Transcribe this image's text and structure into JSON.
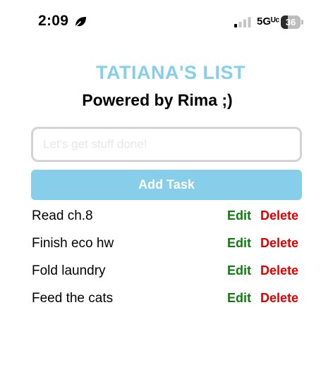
{
  "status_bar": {
    "time": "2:09",
    "network": "5Gᵁᶜ",
    "battery_level": "36",
    "battery_fraction": 0.36,
    "icons": [
      "leaf-focus-icon",
      "cellular-signal-icon",
      "battery-icon"
    ]
  },
  "header": {
    "title": "TATIANA'S LIST",
    "subtitle": "Powered by Rima ;)"
  },
  "input": {
    "value": "",
    "placeholder": "Let's get stuff done!"
  },
  "add_button": {
    "label": "Add Task"
  },
  "tasks": [
    {
      "text": "Read ch.8",
      "edit_label": "Edit",
      "delete_label": "Delete"
    },
    {
      "text": "Finish eco hw",
      "edit_label": "Edit",
      "delete_label": "Delete"
    },
    {
      "text": "Fold laundry",
      "edit_label": "Edit",
      "delete_label": "Delete"
    },
    {
      "text": "Feed the cats",
      "edit_label": "Edit",
      "delete_label": "Delete"
    }
  ],
  "colors": {
    "accent": "#87ceeb",
    "edit": "#0f7a0f",
    "delete": "#e00000",
    "input_border": "#d3d3d3"
  }
}
